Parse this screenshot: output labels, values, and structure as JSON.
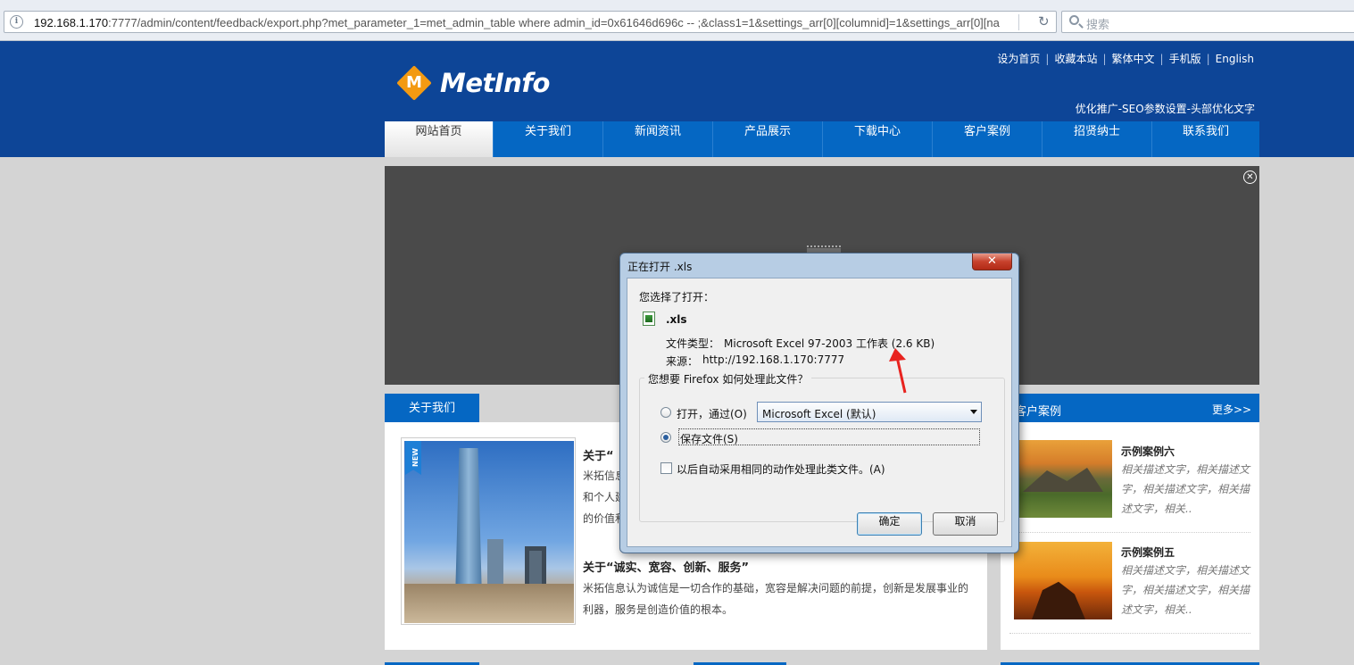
{
  "browser": {
    "url_host": "192.168.1.170",
    "url_rest": ":7777/admin/content/feedback/export.php?met_parameter_1=met_admin_table where admin_id=0x61646d696c -- ;&class1=1&settings_arr[0][columnid]=1&settings_arr[0][na",
    "search_placeholder": "搜索"
  },
  "header": {
    "logo_text": "MetInfo",
    "logo_letter": "M",
    "top_links": [
      "设为首页",
      "收藏本站",
      "繁体中文",
      "手机版",
      "English"
    ],
    "seo_text": "优化推广-SEO参数设置-头部优化文字"
  },
  "nav": {
    "items": [
      "网站首页",
      "关于我们",
      "新闻资讯",
      "产品展示",
      "下载中心",
      "客户案例",
      "招贤纳士",
      "联系我们"
    ]
  },
  "about": {
    "tab": "关于我们",
    "badge": "NEW",
    "heading1": "关于“",
    "lines1": [
      "米拓信息",
      "和个人建",
      "的价值和"
    ],
    "heading2": "关于“诚实、宽容、创新、服务”",
    "lines2": [
      "米拓信息认为诚信是一切合作的基础，宽容是解决问题的前提，创新是发展事业的",
      "利器，服务是创造价值的根本。"
    ]
  },
  "cases": {
    "title": "客户案例",
    "more": "更多>>",
    "items": [
      {
        "title": "示例案例六",
        "desc": [
          "相关描述文字，相关描述文",
          "字，相关描述文字，相关描",
          "述文字，相关.."
        ]
      },
      {
        "title": "示例案例五",
        "desc": [
          "相关描述文字，相关描述文",
          "字，相关描述文字，相关描",
          "述文字，相关.."
        ]
      }
    ]
  },
  "dialog": {
    "title": "正在打开 .xls",
    "close_symbol": "✕",
    "chosen_label": "您选择了打开：",
    "filename": ".xls",
    "type_label": "文件类型：",
    "type_value": "Microsoft Excel 97-2003 工作表 (2.6 KB)",
    "source_label": "来源：",
    "source_value": "http://192.168.1.170:7777",
    "question": "您想要 Firefox 如何处理此文件？",
    "open_with_label": "打开，通过(O)",
    "open_with_app": "Microsoft Excel (默认)",
    "save_label": "保存文件(S)",
    "remember_label": "以后自动采用相同的动作处理此类文件。(A)",
    "ok_label": "确定",
    "cancel_label": "取消"
  },
  "colors": {
    "header_blue": "#0d4597",
    "nav_blue": "#0567c3",
    "logo_orange": "#f39a12",
    "annotation_red": "#e8231f"
  }
}
